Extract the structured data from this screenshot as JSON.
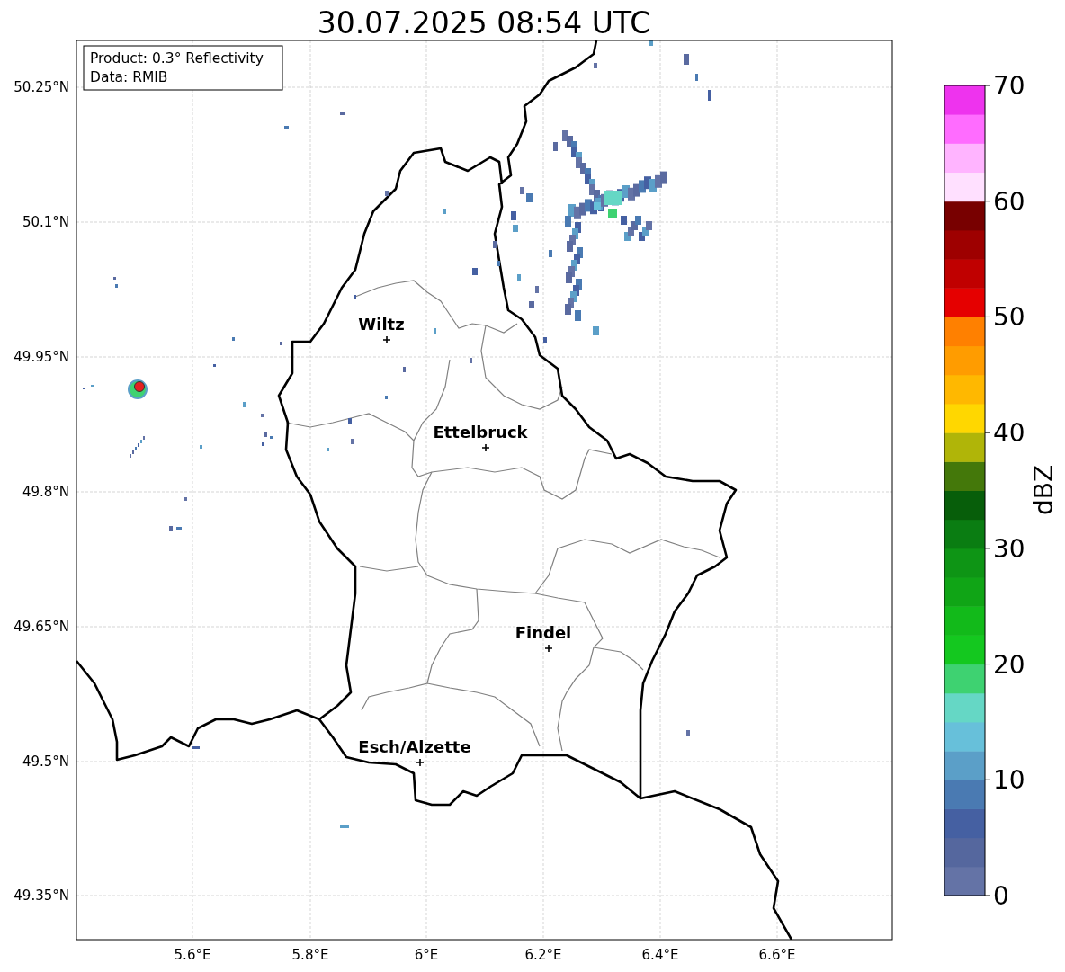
{
  "title": "30.07.2025 08:54 UTC",
  "info_box": {
    "lines": [
      "Product: 0.3° Reflectivity",
      "Data: RMIB"
    ]
  },
  "map": {
    "lat_ticks": [
      "50.25°N",
      "50.1°N",
      "49.95°N",
      "49.8°N",
      "49.65°N",
      "49.5°N",
      "49.35°N"
    ],
    "lon_ticks": [
      "5.6°E",
      "5.8°E",
      "6°E",
      "6.2°E",
      "6.4°E",
      "6.6°E"
    ],
    "cities": [
      {
        "name": "Wiltz"
      },
      {
        "name": "Ettelbruck"
      },
      {
        "name": "Findel"
      },
      {
        "name": "Esch/Alzette"
      }
    ]
  },
  "colorbar": {
    "label": "dBZ",
    "ticks": [
      "70",
      "60",
      "50",
      "40",
      "30",
      "20",
      "10",
      "0"
    ],
    "bands": [
      {
        "color": "#6473a6"
      },
      {
        "color": "#55679e"
      },
      {
        "color": "#4560a2"
      },
      {
        "color": "#4a7ab2"
      },
      {
        "color": "#5b9fc8"
      },
      {
        "color": "#67c0da"
      },
      {
        "color": "#65d7c5"
      },
      {
        "color": "#3ed271"
      },
      {
        "color": "#14c81f"
      },
      {
        "color": "#12ba1a"
      },
      {
        "color": "#10a516"
      },
      {
        "color": "#0e9515"
      },
      {
        "color": "#0a7d12"
      },
      {
        "color": "#075e0a"
      },
      {
        "color": "#44780a"
      },
      {
        "color": "#b0b508"
      },
      {
        "color": "#ffd700"
      },
      {
        "color": "#ffb800"
      },
      {
        "color": "#ff9c00"
      },
      {
        "color": "#ff8000"
      },
      {
        "color": "#e50000"
      },
      {
        "color": "#c00000"
      },
      {
        "color": "#9e0000"
      },
      {
        "color": "#780000"
      },
      {
        "color": "#ffe0ff"
      },
      {
        "color": "#ffb4ff"
      },
      {
        "color": "#ff6cff"
      },
      {
        "color": "#ee33ee"
      }
    ]
  }
}
